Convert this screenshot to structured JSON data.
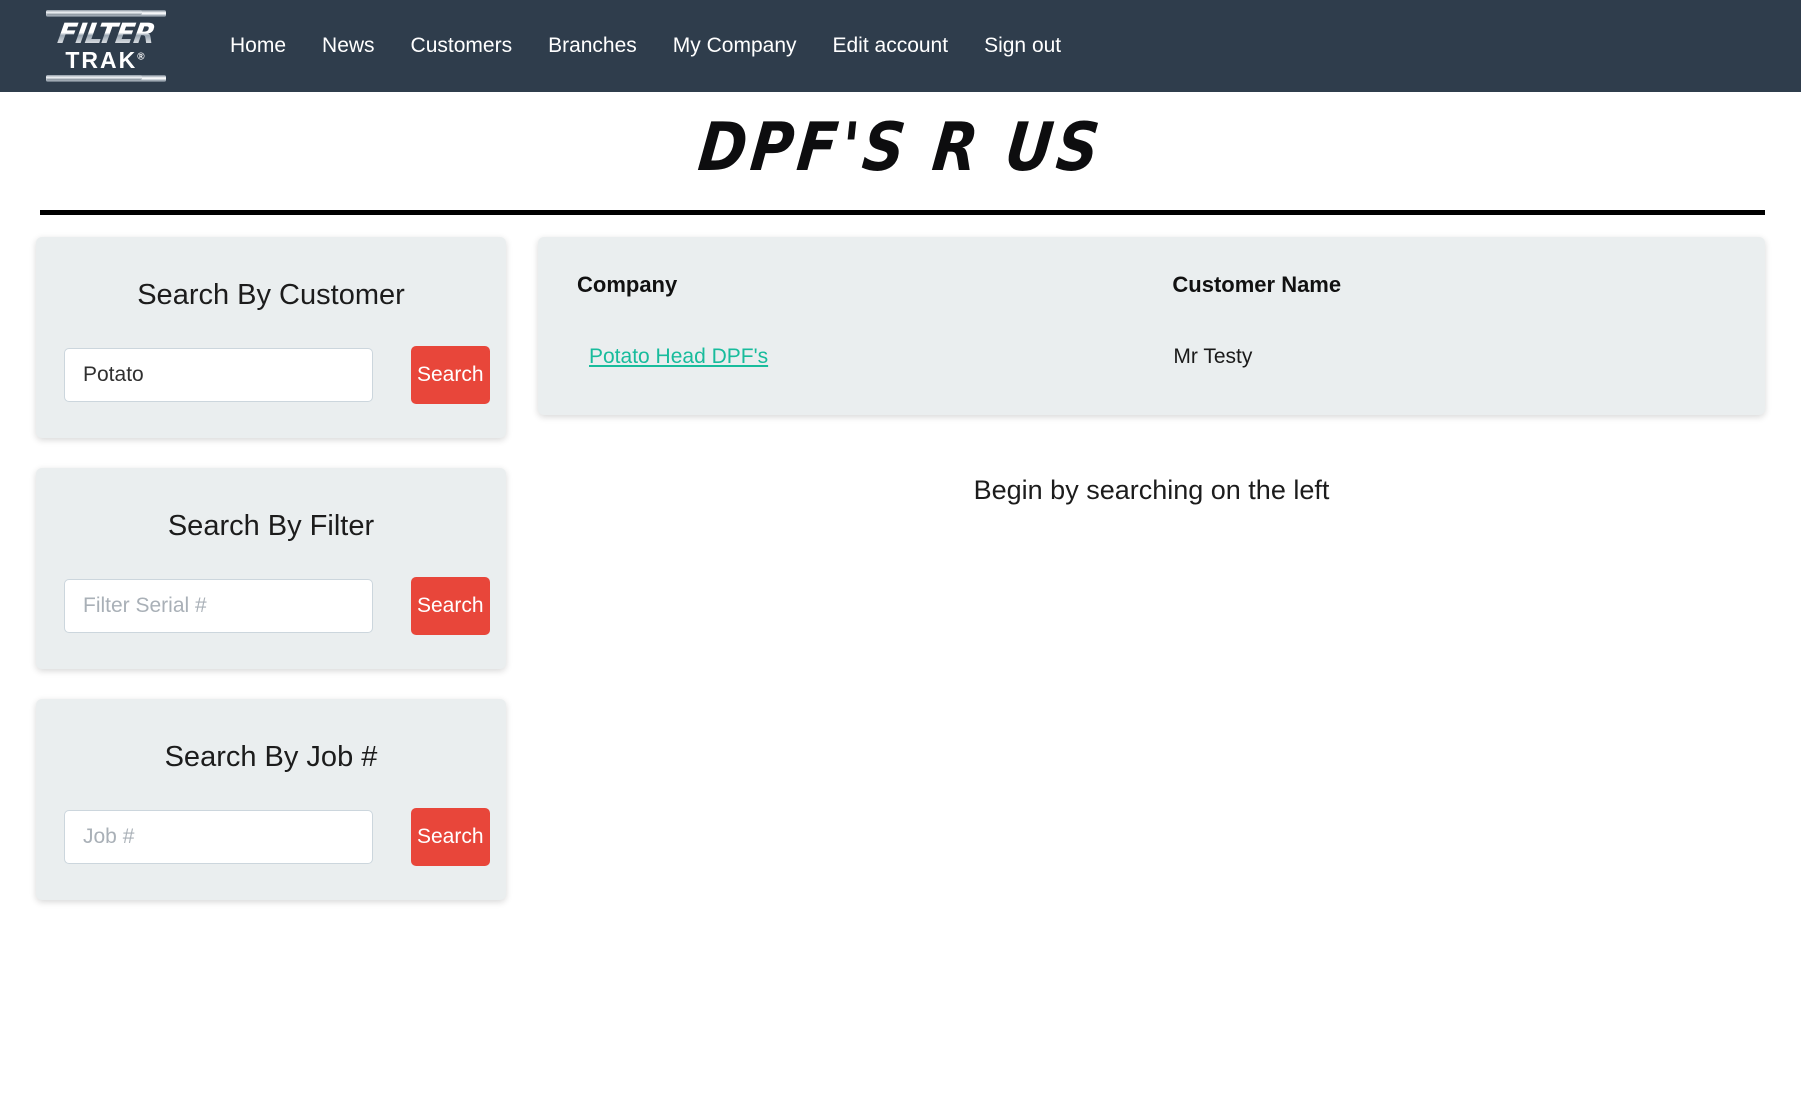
{
  "navbar": {
    "logo": {
      "name": "filter-trak-logo",
      "primary_text": "FILTER",
      "secondary_text": "TRAK",
      "registered_mark": "®"
    },
    "links": [
      {
        "label": "Home",
        "name": "nav-link-home"
      },
      {
        "label": "News",
        "name": "nav-link-news"
      },
      {
        "label": "Customers",
        "name": "nav-link-customers"
      },
      {
        "label": "Branches",
        "name": "nav-link-branches"
      },
      {
        "label": "My Company",
        "name": "nav-link-my-company"
      },
      {
        "label": "Edit account",
        "name": "nav-link-edit-account"
      },
      {
        "label": "Sign out",
        "name": "nav-link-sign-out"
      }
    ],
    "background_color": "#2f3d4c"
  },
  "company": {
    "title": "DPF'S R US"
  },
  "search_panels": [
    {
      "title": "Search By Customer",
      "input_value": "Potato",
      "input_placeholder": "",
      "button_label": "Search"
    },
    {
      "title": "Search By Filter",
      "input_value": "",
      "input_placeholder": "Filter Serial #",
      "button_label": "Search"
    },
    {
      "title": "Search By Job #",
      "input_value": "",
      "input_placeholder": "Job #",
      "button_label": "Search"
    }
  ],
  "results": {
    "headers": {
      "company": "Company",
      "customer_name": "Customer Name"
    },
    "rows": [
      {
        "company": "Potato Head DPF's",
        "customer_name": "Mr Testy"
      }
    ],
    "link_color": "#18bc9c"
  },
  "hint": {
    "text": "Begin by searching on the left"
  },
  "colors": {
    "accent_red": "#e8463a",
    "card_background": "#eaeeef",
    "navbar": "#2f3d4c",
    "link_teal": "#18bc9c"
  }
}
